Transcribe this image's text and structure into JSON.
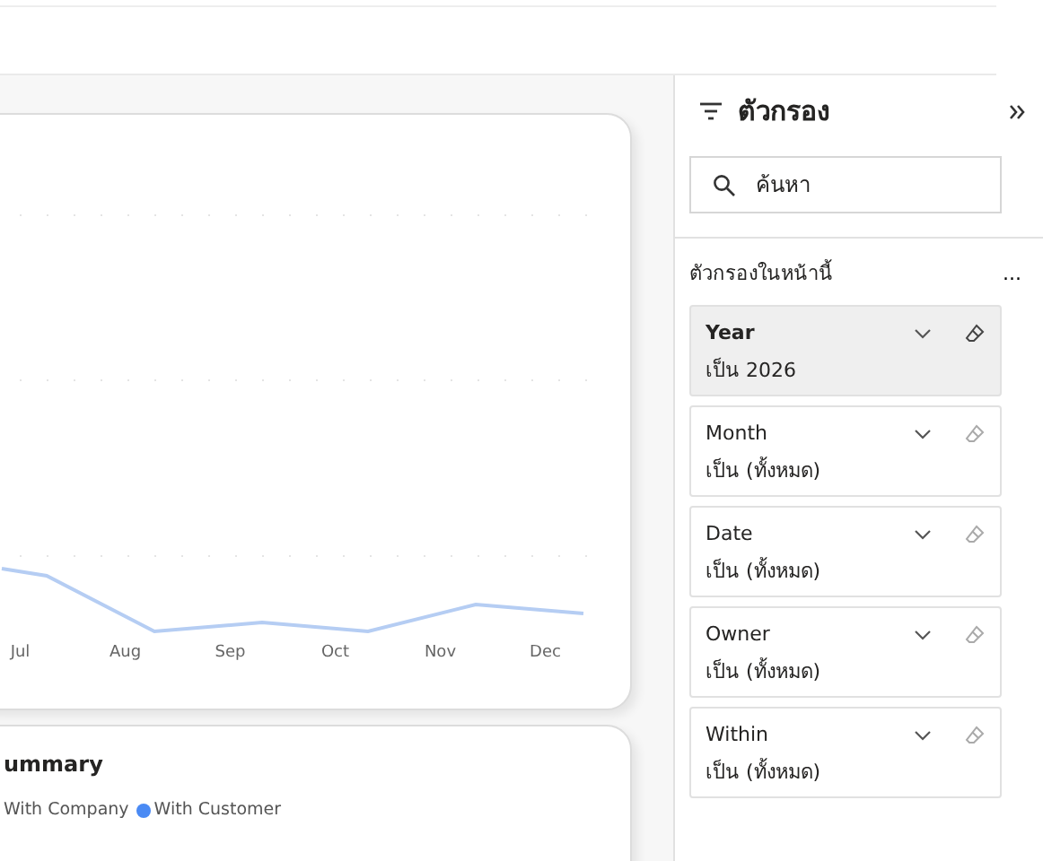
{
  "chart_card": {
    "x_labels": [
      "Jul",
      "Aug",
      "Sep",
      "Oct",
      "Nov",
      "Dec"
    ]
  },
  "summary_card": {
    "title": "ummary",
    "legend": [
      {
        "label": "With Company"
      },
      {
        "label": "With Customer",
        "color": "#4a8af4"
      }
    ]
  },
  "filter_pane": {
    "title": "ตัวกรอง",
    "search": {
      "placeholder": "ค้นหา"
    },
    "section_title": "ตัวกรองในหน้านี้",
    "more": "...",
    "filters": [
      {
        "name": "Year",
        "value": "เป็น 2026",
        "selected": true
      },
      {
        "name": "Month",
        "value": "เป็น (ทั้งหมด)",
        "selected": false
      },
      {
        "name": "Date",
        "value": "เป็น (ทั้งหมด)",
        "selected": false
      },
      {
        "name": "Owner",
        "value": "เป็น (ทั้งหมด)",
        "selected": false
      },
      {
        "name": "Within",
        "value": "เป็น (ทั้งหมด)",
        "selected": false
      }
    ]
  }
}
